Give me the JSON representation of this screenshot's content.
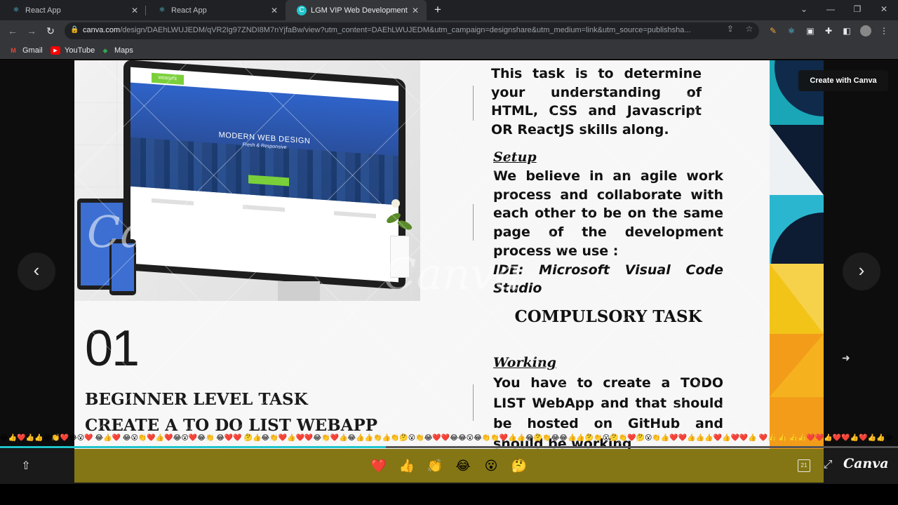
{
  "tabs": [
    {
      "title": "React App",
      "active": false
    },
    {
      "title": "React App",
      "active": false
    },
    {
      "title": "LGM VIP Web Development",
      "active": true
    }
  ],
  "address": {
    "host": "canva.com",
    "path": "/design/DAEhLWUJEDM/qVR2Ig97ZNDI8M7nYjfaBw/view?utm_content=DAEhLWUJEDM&utm_campaign=designshare&utm_medium=link&utm_source=publishsha..."
  },
  "bookmarks": [
    "Gmail",
    "YouTube",
    "Maps"
  ],
  "slide": {
    "mockup": {
      "hero_title": "MODERN WEB DESIGN",
      "hero_sub": "Fresh & Responsive",
      "tag": "WEBSITE"
    },
    "watermark": "Canva",
    "number": "01",
    "level_line1": "BEGINNER LEVEL TASK",
    "level_line2": "CREATE A TO DO LIST WEBAPP",
    "intro": "This task is to determine your understanding of HTML, CSS and Javascript OR ReactJS skills along.",
    "setup_heading": "Setup",
    "setup_body": "We believe in an agile work process and collaborate with each other to be on the same page of the development process we use :",
    "ide": "IDE: Microsoft Visual Code Studio",
    "compulsory": "COMPULSORY TASK",
    "working_heading": "Working",
    "working_body": "You have to create a TODO LIST WebApp and that should be hosted on GitHub and should be working"
  },
  "viewer": {
    "create_label": "Create with Canva",
    "brand": "Canva",
    "page_indicator": "21",
    "progress": 0.43,
    "reactions": [
      "❤️",
      "👍",
      "👏",
      "😂",
      "😮",
      "🤔"
    ],
    "emoji_strip": "😂👍❤️👍👍😂👏❤️😂😮❤️ 😂👍❤️ 😂😮👏❤️👍❤️😂😮❤️😂👏 😂❤️❤️ 🤔👍😂👏❤️👍❤️❤️😂👏❤️👍😂👍👍👏👍👏🤔😮👏😂❤️❤️😂😂😮😂👏👏❤️👍👍😂🤔👏😂😂👍👍🤔👏😮🤔👏❤️🤔😮👏👍❤️❤️👍👍👍❤️👍❤️❤️👍 ❤️👍 👍 👍👍❤️❤️👍❤️❤️👍❤️👍👍😂"
  },
  "colors": {
    "tabbar": "#202124",
    "toolbar": "#35363a",
    "progress": "#20c4cb",
    "bottom_panel": "#8a7b14",
    "hero_blue": "#2f63c9",
    "accent_green": "#7ad03a"
  }
}
